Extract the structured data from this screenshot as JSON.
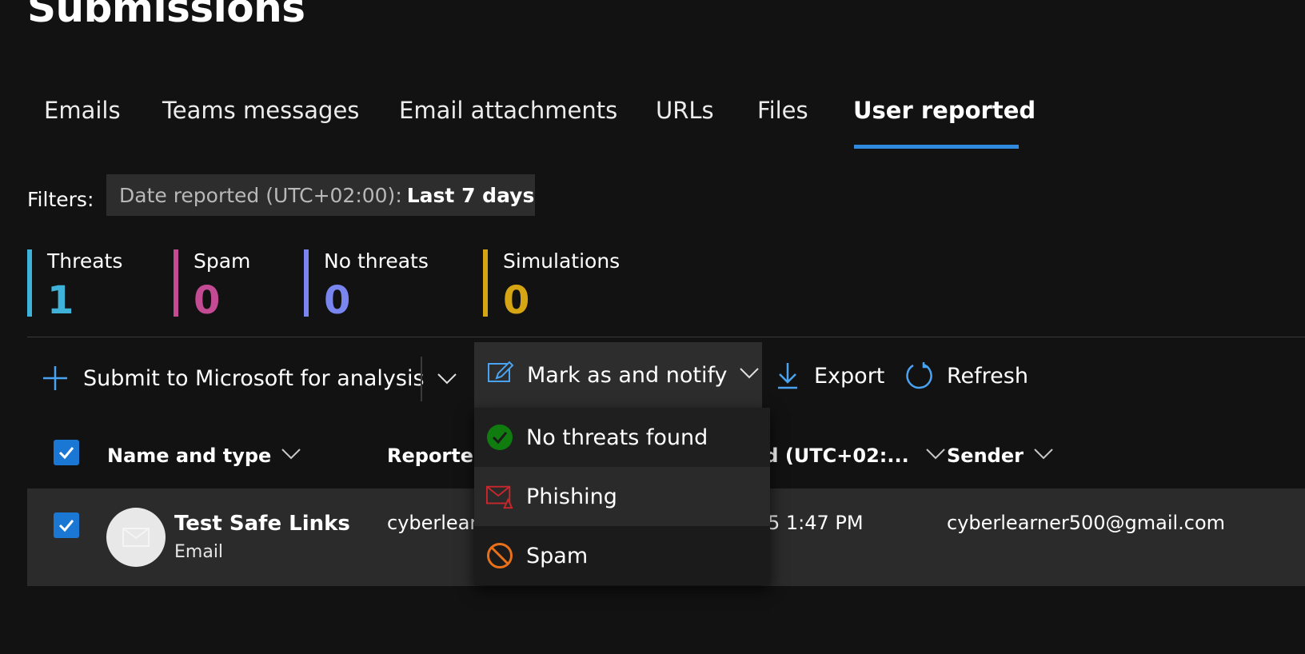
{
  "page": {
    "title": "Submissions"
  },
  "tabs": [
    {
      "label": "Emails"
    },
    {
      "label": "Teams messages"
    },
    {
      "label": "Email attachments"
    },
    {
      "label": "URLs"
    },
    {
      "label": "Files"
    },
    {
      "label": "User reported"
    }
  ],
  "active_tab": "User reported",
  "filters": {
    "label": "Filters:",
    "chip_key": "Date reported (UTC+02:00):",
    "chip_value": "Last 7 days"
  },
  "counters": [
    {
      "label": "Threats",
      "value": "1",
      "color": "#3fb2d9"
    },
    {
      "label": "Spam",
      "value": "0",
      "color": "#c24b94"
    },
    {
      "label": "No threats",
      "value": "0",
      "color": "#7a86f0"
    },
    {
      "label": "Simulations",
      "value": "0",
      "color": "#d5a514"
    }
  ],
  "toolbar": {
    "submit_label": "Submit to Microsoft for analysis",
    "mark_label": "Mark as and notify",
    "export_label": "Export",
    "refresh_label": "Refresh"
  },
  "table": {
    "headers": {
      "name": "Name and type",
      "reported": "Reported",
      "date": "ed (UTC+02:...",
      "sender": "Sender"
    },
    "rows": [
      {
        "name": "Test Safe Links",
        "type": "Email",
        "reported_by": "cyberlearn",
        "date": "5 1:47 PM",
        "sender": "cyberlearner500@gmail.com",
        "checked": true
      }
    ]
  },
  "dropdown": {
    "items": [
      {
        "label": "No threats found",
        "icon": "check-circle-icon"
      },
      {
        "label": "Phishing",
        "icon": "phishing-mail-icon"
      },
      {
        "label": "Spam",
        "icon": "block-icon"
      }
    ]
  },
  "colors": {
    "accent": "#1a78d4",
    "tab_underline": "#2f8ae0",
    "success": "#107c10",
    "phishing": "#c9272d",
    "spam": "#e8701a"
  }
}
